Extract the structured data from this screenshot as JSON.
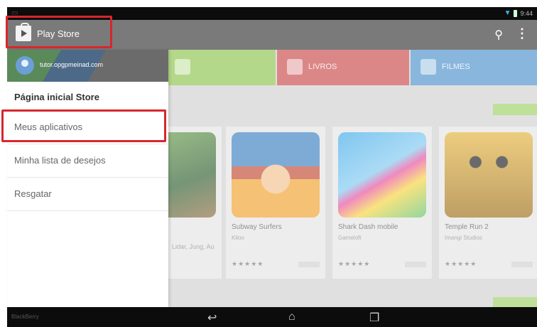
{
  "status_bar": {
    "time": "9:44"
  },
  "action_bar": {
    "title": "Play Store",
    "search_icon": "search-icon",
    "overflow_icon": "overflow-menu-icon"
  },
  "categories": [
    {
      "label": "",
      "color": "#8bc34a"
    },
    {
      "label": "LIVROS",
      "color": "#c94848"
    },
    {
      "label": "FILMES",
      "color": "#4a90c9"
    }
  ],
  "drawer": {
    "account_email": "tutor.opgpmeinad.com",
    "home_label": "Página inicial Store",
    "items": [
      {
        "label": "Meus aplicativos"
      },
      {
        "label": "Minha lista de desejos"
      },
      {
        "label": "Resgatar"
      }
    ]
  },
  "apps": [
    {
      "name": "",
      "dev": ""
    },
    {
      "name": "Subway Surfers",
      "dev": "Kiloo",
      "stars": "★★★★★"
    },
    {
      "name": "Shark Dash mobile",
      "dev": "Gameloft",
      "stars": "★★★★★"
    },
    {
      "name": "Temple Run 2",
      "dev": "Imangi Studios",
      "stars": "★★★★★"
    }
  ],
  "partial_text": "Lidar, Jung, Au",
  "nav_bar": {
    "corner_text": "BlackBerry",
    "back_icon": "back-icon",
    "home_icon": "home-icon",
    "recents_icon": "recents-icon"
  },
  "colors": {
    "highlight": "#d8262e",
    "action_bar": "#7a7a7a"
  }
}
